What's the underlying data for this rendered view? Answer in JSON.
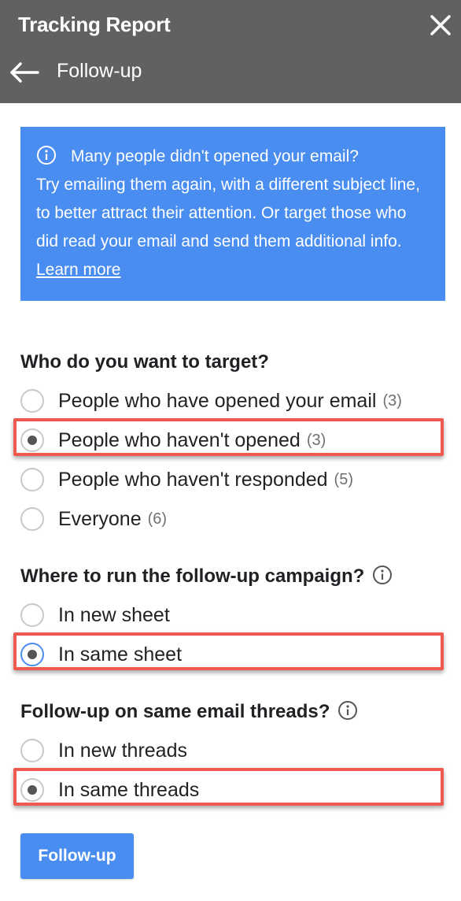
{
  "header": {
    "title": "Tracking Report",
    "subtitle": "Follow-up"
  },
  "info": {
    "line1": "Many people didn't opened your email?",
    "body": "Try emailing them again, with a different subject line, to better attract their attention. Or target those who did read your email and send them additional info.",
    "link": "Learn more"
  },
  "target": {
    "title": "Who do you want to target?",
    "options": [
      {
        "label": "People who have opened your email",
        "count": "(3)",
        "checked": false
      },
      {
        "label": "People who haven't opened",
        "count": "(3)",
        "checked": true
      },
      {
        "label": "People who haven't responded",
        "count": "(5)",
        "checked": false
      },
      {
        "label": "Everyone",
        "count": "(6)",
        "checked": false
      }
    ]
  },
  "campaign": {
    "title": "Where to run the follow-up campaign?",
    "options": [
      {
        "label": "In new sheet",
        "checked": false
      },
      {
        "label": "In same sheet",
        "checked": true
      }
    ]
  },
  "threads": {
    "title": "Follow-up on same email threads?",
    "options": [
      {
        "label": "In new threads",
        "checked": false
      },
      {
        "label": "In same threads",
        "checked": true
      }
    ]
  },
  "action": {
    "button_label": "Follow-up"
  },
  "colors": {
    "header_bg": "#616161",
    "info_bg": "#4a8df0",
    "highlight": "#ef5a4e",
    "button_bg": "#4a8df0"
  }
}
